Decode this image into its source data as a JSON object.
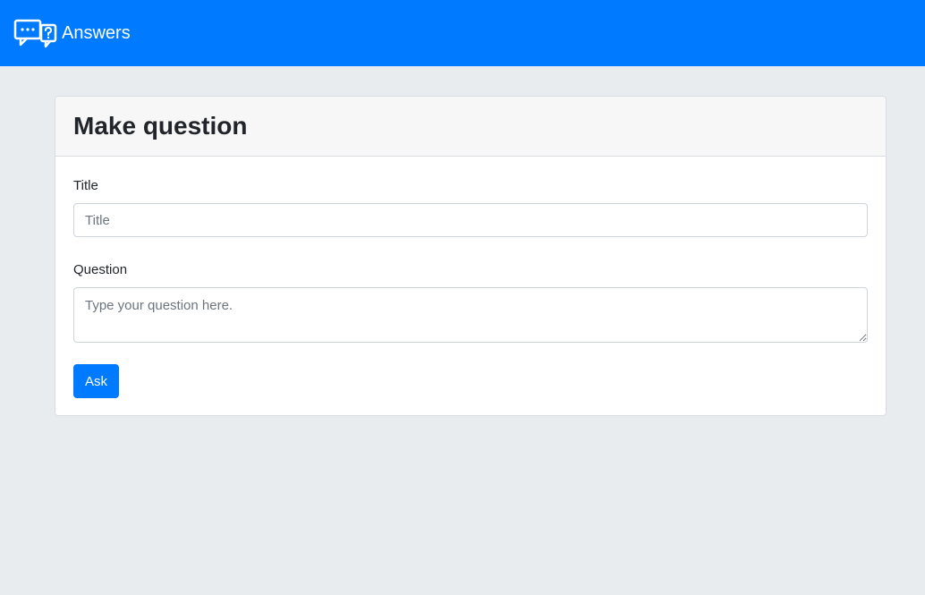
{
  "navbar": {
    "brand_icon": "speech-bubbles-question-icon",
    "brand_text": "Answers"
  },
  "form": {
    "heading": "Make question",
    "title_label": "Title",
    "title_placeholder": "Title",
    "title_value": "",
    "question_label": "Question",
    "question_placeholder": "Type your question here.",
    "question_value": "",
    "submit_label": "Ask"
  },
  "colors": {
    "primary": "#007bff",
    "background": "#e9ecef",
    "card_header": "#f7f7f7",
    "text": "#212529"
  }
}
